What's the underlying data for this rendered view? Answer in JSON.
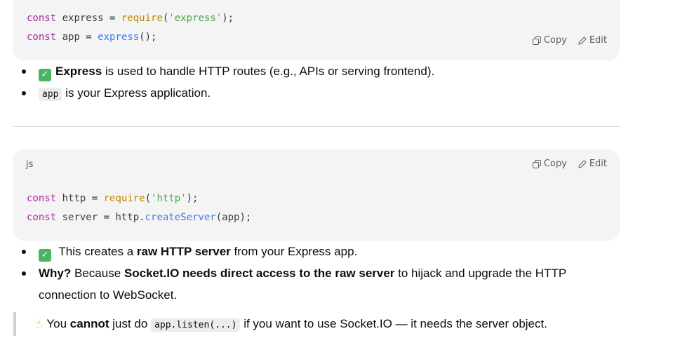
{
  "block1": {
    "lines": [
      [
        {
          "t": "const",
          "c": "kw"
        },
        {
          "t": " express = "
        },
        {
          "t": "require",
          "c": "fn"
        },
        {
          "t": "("
        },
        {
          "t": "'express'",
          "c": "str"
        },
        {
          "t": ");"
        }
      ],
      [
        {
          "t": "const",
          "c": "kw"
        },
        {
          "t": " app = "
        },
        {
          "t": "express",
          "c": "mth"
        },
        {
          "t": "();"
        }
      ]
    ],
    "copy_label": "Copy",
    "edit_label": "Edit"
  },
  "bullets1": {
    "item1": {
      "bold": "Express",
      "rest": " is used to handle HTTP routes (e.g., APIs or serving frontend)."
    },
    "item2": {
      "code": "app",
      "rest": " is your Express application."
    }
  },
  "block2": {
    "lang": "js",
    "lines": [
      [
        {
          "t": "const",
          "c": "kw"
        },
        {
          "t": " http = "
        },
        {
          "t": "require",
          "c": "fn"
        },
        {
          "t": "("
        },
        {
          "t": "'http'",
          "c": "str"
        },
        {
          "t": ");"
        }
      ],
      [
        {
          "t": "const",
          "c": "kw"
        },
        {
          "t": " server = http."
        },
        {
          "t": "createServer",
          "c": "mth"
        },
        {
          "t": "(app);"
        }
      ]
    ],
    "copy_label": "Copy",
    "edit_label": "Edit"
  },
  "bullets2": {
    "item1": {
      "pre": " This creates a ",
      "bold": "raw HTTP server",
      "rest": " from your Express app."
    },
    "item2": {
      "bold1": "Why?",
      "mid": " Because ",
      "bold2": "Socket.IO needs direct access to the raw server",
      "rest": " to hijack and upgrade the HTTP connection to WebSocket."
    }
  },
  "quote": {
    "pre": "You ",
    "bold": "cannot",
    "mid": " just do ",
    "code": "app.listen(...)",
    "rest": " if you want to use Socket.IO — it needs the server object."
  },
  "icons": {
    "check": "check-emoji-icon",
    "hand": "pointing-up-emoji-icon",
    "copy": "copy-icon",
    "edit": "edit-pencil-icon"
  }
}
